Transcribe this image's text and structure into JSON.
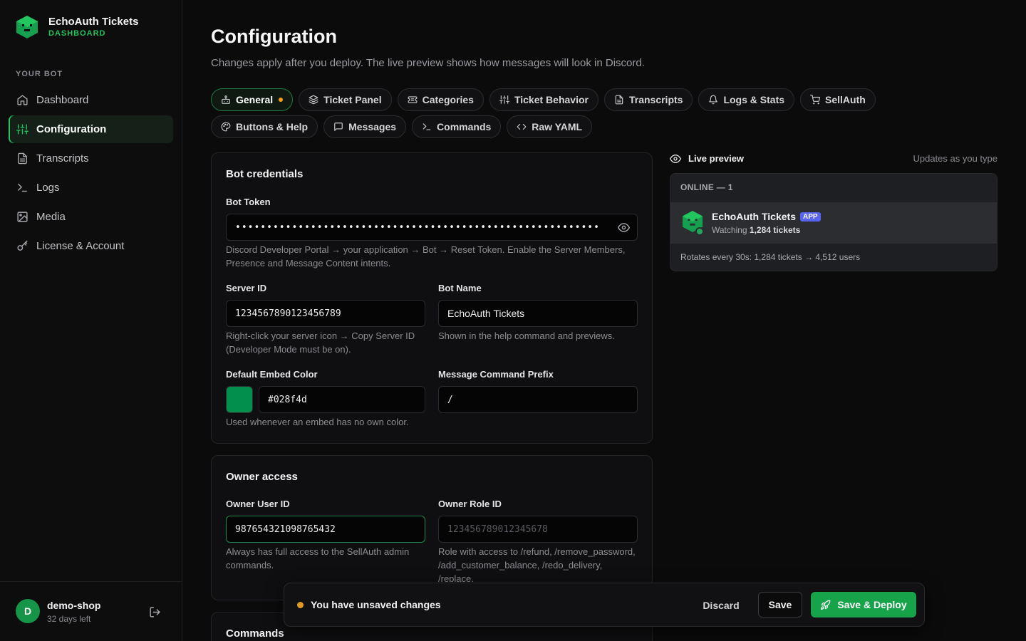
{
  "brand": {
    "name": "EchoAuth Tickets",
    "subtitle": "DASHBOARD"
  },
  "sidebar": {
    "section_label": "YOUR BOT",
    "items": [
      {
        "label": "Dashboard",
        "icon": "home-icon",
        "active": false
      },
      {
        "label": "Configuration",
        "icon": "sliders-icon",
        "active": true
      },
      {
        "label": "Transcripts",
        "icon": "document-icon",
        "active": false
      },
      {
        "label": "Logs",
        "icon": "terminal-icon",
        "active": false
      },
      {
        "label": "Media",
        "icon": "image-icon",
        "active": false
      },
      {
        "label": "License & Account",
        "icon": "key-icon",
        "active": false
      }
    ],
    "user": {
      "initial": "D",
      "name": "demo-shop",
      "sub": "32 days left"
    }
  },
  "header": {
    "title": "Configuration",
    "subtitle": "Changes apply after you deploy. The live preview shows how messages will look in Discord."
  },
  "tabs": [
    {
      "label": "General",
      "icon": "bot-icon",
      "active": true,
      "dirty": true
    },
    {
      "label": "Ticket Panel",
      "icon": "layers-icon"
    },
    {
      "label": "Categories",
      "icon": "ticket-icon"
    },
    {
      "label": "Ticket Behavior",
      "icon": "sliders-icon"
    },
    {
      "label": "Transcripts",
      "icon": "document-icon"
    },
    {
      "label": "Logs & Stats",
      "icon": "bell-icon"
    },
    {
      "label": "SellAuth",
      "icon": "cart-icon"
    },
    {
      "label": "Buttons & Help",
      "icon": "palette-icon"
    },
    {
      "label": "Messages",
      "icon": "message-icon"
    },
    {
      "label": "Commands",
      "icon": "terminal-icon"
    },
    {
      "label": "Raw YAML",
      "icon": "code-icon"
    }
  ],
  "credentials": {
    "title": "Bot credentials",
    "token": {
      "label": "Bot Token",
      "value": "••••••••••••••••••••••••••••••••••••••••••••••••••••••••••",
      "help": "Discord Developer Portal → your application → Bot → Reset Token. Enable the Server Members, Presence and Message Content intents."
    },
    "server_id": {
      "label": "Server ID",
      "value": "1234567890123456789",
      "help": "Right-click your server icon → Copy Server ID (Developer Mode must be on)."
    },
    "bot_name": {
      "label": "Bot Name",
      "value": "EchoAuth Tickets",
      "help": "Shown in the help command and previews."
    },
    "embed_color": {
      "label": "Default Embed Color",
      "value": "#028f4d",
      "help": "Used whenever an embed has no own color."
    },
    "prefix": {
      "label": "Message Command Prefix",
      "value": "/"
    }
  },
  "owner": {
    "title": "Owner access",
    "user_id": {
      "label": "Owner User ID",
      "value": "987654321098765432",
      "help": "Always has full access to the SellAuth admin commands."
    },
    "role_id": {
      "label": "Owner Role ID",
      "placeholder": "123456789012345678",
      "help": "Role with access to /refund, /remove_password, /add_customer_balance, /redo_delivery, /replace."
    }
  },
  "commands_card": {
    "title": "Commands"
  },
  "preview": {
    "title": "Live preview",
    "note": "Updates as you type",
    "online": "ONLINE — 1",
    "bot_name": "EchoAuth Tickets",
    "badge": "APP",
    "status_prefix": "Watching ",
    "status_value": "1,284 tickets",
    "footer": "Rotates every 30s: 1,284 tickets → 4,512 users"
  },
  "unsaved_bar": {
    "message": "You have unsaved changes",
    "discard": "Discard",
    "save": "Save",
    "deploy": "Save & Deploy"
  },
  "colors": {
    "accent": "#22c55e",
    "embed": "#028f4d",
    "warning": "#e29a26",
    "discord_badge": "#5865f2"
  }
}
